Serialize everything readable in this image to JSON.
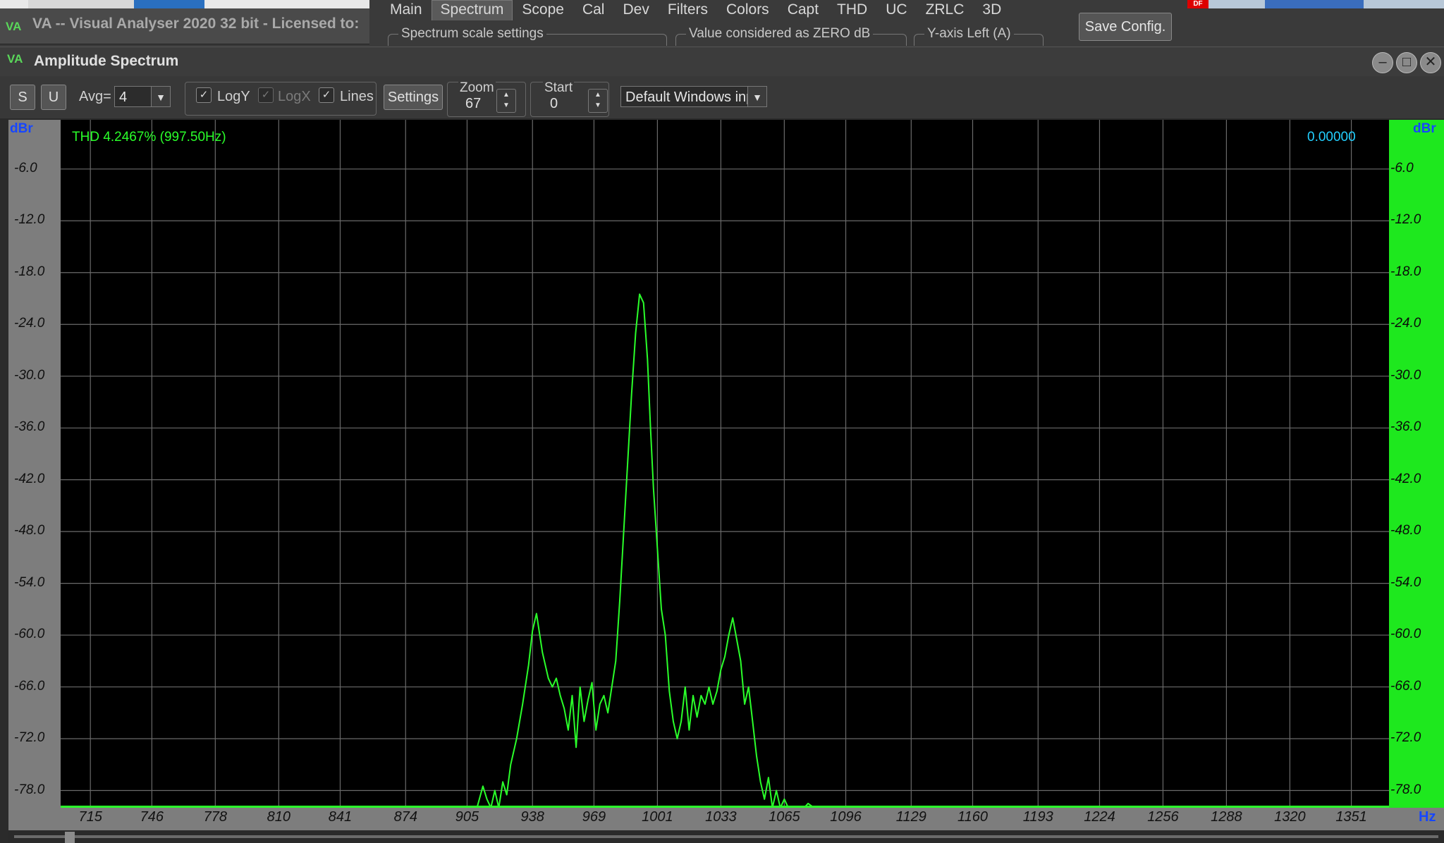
{
  "app": {
    "title": "VA -- Visual Analyser 2020 32 bit - Licensed to:",
    "logo": "VA",
    "menu_tabs": [
      "Main",
      "Spectrum",
      "Scope",
      "Cal",
      "Dev",
      "Filters",
      "Colors",
      "Capt",
      "THD",
      "UC",
      "ZRLC",
      "3D"
    ],
    "active_tab": "Spectrum",
    "group_boxes": [
      "Spectrum scale settings",
      "Value considered as ZERO dB",
      "Y-axis Left (A)"
    ],
    "save_config": "Save Config.",
    "top_right_badge": "DF"
  },
  "window": {
    "title": "Amplitude Spectrum",
    "logo": "VA",
    "controls": [
      "minimize",
      "maximize",
      "close"
    ]
  },
  "toolbar": {
    "s_button": "S",
    "u_button": "U",
    "avg_label": "Avg=",
    "avg_value": "4",
    "logy_label": "LogY",
    "logy_checked": true,
    "logx_label": "LogX",
    "logx_checked": true,
    "lines_label": "Lines",
    "lines_checked": true,
    "settings_button": "Settings",
    "zoom_label": "Zoom",
    "zoom_value": "67",
    "start_label": "Start",
    "start_value": "0",
    "input_device": "Default Windows input"
  },
  "plot": {
    "thd_text": "THD 4.2467% (997.50Hz)",
    "readout": "0.00000",
    "y_unit": "dBr",
    "x_unit": "Hz",
    "colors": {
      "trace": "#2aff2a",
      "grid": "#6a6a6a",
      "background": "#000000",
      "right_axis": "#1ee81e"
    }
  },
  "chart_data": {
    "type": "line",
    "xlabel": "Hz",
    "ylabel": "dBr",
    "grid": true,
    "x_ticks": [
      "715",
      "746",
      "778",
      "810",
      "841",
      "874",
      "905",
      "938",
      "969",
      "1001",
      "1033",
      "1065",
      "1096",
      "1129",
      "1160",
      "1193",
      "1224",
      "1256",
      "1288",
      "1320",
      "1351"
    ],
    "y_ticks": [
      "-6.0",
      "-12.0",
      "-18.0",
      "-24.0",
      "-30.0",
      "-36.0",
      "-42.0",
      "-48.0",
      "-54.0",
      "-60.0",
      "-66.0",
      "-72.0",
      "-78.0"
    ],
    "ylim": [
      -80.0,
      -0.3
    ],
    "xlim": [
      700,
      1370
    ],
    "series": [
      {
        "x": [
          910,
          913,
          915,
          917,
          919,
          921,
          923,
          925,
          927,
          930,
          933,
          936,
          938,
          940,
          943,
          946,
          948,
          950,
          952,
          954,
          956,
          958,
          960,
          962,
          964,
          966,
          968,
          970,
          972,
          974,
          976,
          978,
          980,
          982,
          984,
          986,
          988,
          990,
          992,
          994,
          996,
          997.5,
          999,
          1001,
          1003,
          1005,
          1007,
          1009,
          1011,
          1013,
          1015,
          1017,
          1019,
          1021,
          1023,
          1025,
          1027,
          1029,
          1031,
          1033,
          1035,
          1037,
          1039,
          1041,
          1043,
          1045,
          1047,
          1049,
          1051,
          1053,
          1055,
          1057,
          1059,
          1061,
          1063,
          1065,
          1067,
          1069,
          1071,
          1073,
          1075,
          1077,
          1080,
          1085,
          1090,
          1100
        ],
        "y": [
          -80.0,
          -77.5,
          -79.0,
          -80.0,
          -78.0,
          -80.0,
          -77.0,
          -78.5,
          -75.0,
          -72.0,
          -68.0,
          -63.5,
          -59.5,
          -57.5,
          -62.0,
          -65.0,
          -66.0,
          -65.0,
          -67.0,
          -68.5,
          -71.0,
          -67.0,
          -73.0,
          -66.0,
          -70.0,
          -67.5,
          -65.5,
          -71.0,
          -68.0,
          -67.0,
          -69.0,
          -66.0,
          -63.0,
          -56.0,
          -48.0,
          -40.0,
          -32.0,
          -25.0,
          -20.5,
          -21.5,
          -28.0,
          -36.0,
          -43.0,
          -50.0,
          -57.0,
          -60.0,
          -66.5,
          -70.0,
          -72.0,
          -70.0,
          -66.0,
          -71.0,
          -67.0,
          -69.5,
          -67.0,
          -68.0,
          -66.0,
          -68.0,
          -66.5,
          -64.0,
          -62.5,
          -60.0,
          -58.0,
          -60.5,
          -63.0,
          -68.0,
          -66.0,
          -70.0,
          -74.0,
          -77.0,
          -79.0,
          -76.5,
          -80.0,
          -78.0,
          -80.0,
          -79.0,
          -80.0,
          -80.0,
          -80.0,
          -80.0,
          -80.0,
          -79.5,
          -80.0,
          -80.0,
          -80.0,
          -80.0
        ]
      }
    ]
  }
}
